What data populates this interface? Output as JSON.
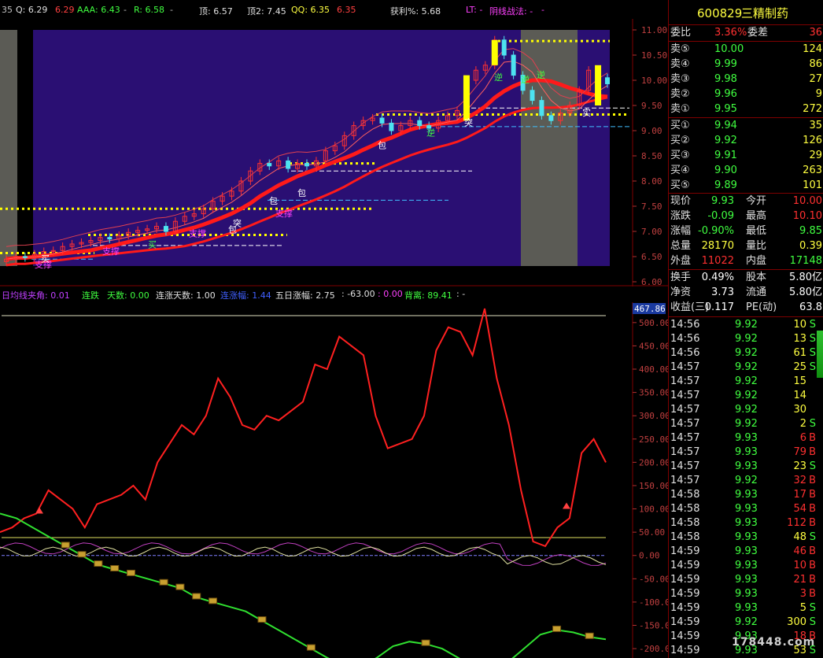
{
  "top_indicators": {
    "period": "35",
    "q_label": "Q: 6.29",
    "q_val2": "6.29",
    "aaa": "AAA: 6.43",
    "dash1": "-",
    "r": "R: 6.58",
    "dash2": "-",
    "top1": "顶: 6.57",
    "top2": "顶2: 7.45",
    "qq": "QQ: 6.35",
    "qq2": "6.35",
    "profit": "获利%: 5.68",
    "lt": "LT: -",
    "yinxian": "阴线战法: -",
    "dash3": "-"
  },
  "sub_header": {
    "angle": "日均线夹角: 0.01",
    "lianzhang": "连跌",
    "tianshu": "天数: 0.00",
    "lianzhangtianshu": "连涨天数: 1.00",
    "lianzhangfu": "连涨幅: 1.44",
    "wuri": "五日涨幅: 2.75",
    "neg63": ": -63.00",
    "zero": ": 0.00",
    "beili": "背离: 89.41",
    "dash": ":  -"
  },
  "colors": {
    "main_bg": "#2a0f73",
    "shade": "#5b5b55",
    "ma_thick": "#ff1a1a",
    "up_candle": "#ff3030",
    "down_candle": "#4de3f0",
    "yellow": "#ffff00",
    "red_line": "#ff2020",
    "green_line": "#30e030",
    "magenta": "#c040c0",
    "axis": "#b03030"
  },
  "chart_data": [
    {
      "type": "candlestick",
      "name": "main",
      "y_ticks": [
        "11.00",
        "10.50",
        "10.00",
        "9.50",
        "9.00",
        "8.50",
        "8.00",
        "7.50",
        "7.00",
        "6.50",
        "6.00"
      ],
      "ylim": [
        6.0,
        11.0
      ],
      "close": [
        6.45,
        6.5,
        6.48,
        6.55,
        6.6,
        6.62,
        6.7,
        6.75,
        6.78,
        6.82,
        6.88,
        6.85,
        6.92,
        6.98,
        7.02,
        7.05,
        7.1,
        7.0,
        7.2,
        7.3,
        7.35,
        7.45,
        7.6,
        7.7,
        7.8,
        8.0,
        8.2,
        8.35,
        8.3,
        8.4,
        8.25,
        8.35,
        8.3,
        8.4,
        8.6,
        8.7,
        8.9,
        9.1,
        9.2,
        9.25,
        9.15,
        9.0,
        9.1,
        9.2,
        9.1,
        9.05,
        9.2,
        9.3,
        9.4,
        10.0,
        10.2,
        10.3,
        10.8,
        10.5,
        10.1,
        9.8,
        9.6,
        9.3,
        9.2,
        9.35,
        9.5,
        9.8,
        10.2,
        10.05,
        9.93
      ],
      "annotations": [
        "支撑",
        "买",
        "支撑",
        "支撑",
        "突",
        "包",
        "包",
        "包",
        "包",
        "支撑",
        "逆",
        "逆",
        "突",
        "逆",
        "逆",
        "实",
        "买"
      ]
    },
    {
      "type": "line",
      "name": "sub",
      "y_ticks": [
        "500.00",
        "450.00",
        "400.00",
        "350.00",
        "300.00",
        "250.00",
        "200.00",
        "150.00",
        "100.00",
        "50.00",
        "0.00",
        "-50.00",
        "-100.00",
        "-150.00",
        "-200.00"
      ],
      "ylim": [
        -210,
        520
      ],
      "marker_value": "467.86",
      "series": [
        {
          "values": [
            50,
            60,
            80,
            90,
            140,
            120,
            100,
            60,
            110,
            120,
            130,
            150,
            120,
            200,
            240,
            280,
            260,
            300,
            380,
            340,
            280,
            270,
            300,
            290,
            310,
            330,
            410,
            400,
            470,
            450,
            430,
            300,
            230,
            240,
            250,
            300,
            440,
            490,
            480,
            430,
            530,
            380,
            280,
            140,
            30,
            20,
            60,
            80,
            220,
            250,
            200
          ]
        },
        {
          "values": [
            90,
            80,
            60,
            40,
            20,
            0,
            -20,
            -30,
            -40,
            -50,
            -60,
            -70,
            -90,
            -100,
            -110,
            -120,
            -140,
            -160,
            -180,
            -200,
            -220,
            -235,
            -240,
            -220,
            -195,
            -185,
            -190,
            -200,
            -220,
            -240,
            -250,
            -230,
            -200,
            -170,
            -160,
            -165,
            -175,
            -180
          ]
        }
      ]
    }
  ],
  "panel": {
    "code": "600829",
    "name": "三精制药",
    "weibi_label": "委比",
    "weibi_val": "3.36%",
    "weicha_label": "委差",
    "weicha_val": "36",
    "asks": [
      {
        "label": "卖⑤",
        "price": "10.00",
        "vol": "124"
      },
      {
        "label": "卖④",
        "price": "9.99",
        "vol": "86"
      },
      {
        "label": "卖③",
        "price": "9.98",
        "vol": "27"
      },
      {
        "label": "卖②",
        "price": "9.96",
        "vol": "9"
      },
      {
        "label": "卖①",
        "price": "9.95",
        "vol": "272"
      }
    ],
    "bids": [
      {
        "label": "买①",
        "price": "9.94",
        "vol": "35"
      },
      {
        "label": "买②",
        "price": "9.92",
        "vol": "126"
      },
      {
        "label": "买③",
        "price": "9.91",
        "vol": "29"
      },
      {
        "label": "买④",
        "price": "9.90",
        "vol": "263"
      },
      {
        "label": "买⑤",
        "price": "9.89",
        "vol": "101"
      }
    ],
    "quote": [
      {
        "l1": "现价",
        "v1": "9.93",
        "l2": "今开",
        "v2": "10.00"
      },
      {
        "l1": "涨跌",
        "v1": "-0.09",
        "l2": "最高",
        "v2": "10.10"
      },
      {
        "l1": "涨幅",
        "v1": "-0.90%",
        "l2": "最低",
        "v2": "9.85"
      },
      {
        "l1": "总量",
        "v1": "28170",
        "l2": "量比",
        "v2": "0.39"
      },
      {
        "l1": "外盘",
        "v1": "11022",
        "l2": "内盘",
        "v2": "17148"
      }
    ],
    "stats": [
      {
        "l1": "换手",
        "v1": "0.49%",
        "l2": "股本",
        "v2": "5.80亿"
      },
      {
        "l1": "净资",
        "v1": "3.73",
        "l2": "流通",
        "v2": "5.80亿"
      },
      {
        "l1": "收益(三)",
        "v1": "0.117",
        "l2": "PE(动)",
        "v2": "63.8"
      }
    ],
    "ticks": [
      {
        "t": "14:56",
        "p": "9.92",
        "v": "10",
        "s": "S"
      },
      {
        "t": "14:56",
        "p": "9.92",
        "v": "13",
        "s": "S"
      },
      {
        "t": "14:56",
        "p": "9.92",
        "v": "61",
        "s": "S"
      },
      {
        "t": "14:57",
        "p": "9.92",
        "v": "25",
        "s": "S"
      },
      {
        "t": "14:57",
        "p": "9.92",
        "v": "15",
        "s": ""
      },
      {
        "t": "14:57",
        "p": "9.92",
        "v": "14",
        "s": ""
      },
      {
        "t": "14:57",
        "p": "9.92",
        "v": "30",
        "s": ""
      },
      {
        "t": "14:57",
        "p": "9.92",
        "v": "2",
        "s": "S"
      },
      {
        "t": "14:57",
        "p": "9.93",
        "v": "6",
        "s": "B"
      },
      {
        "t": "14:57",
        "p": "9.93",
        "v": "79",
        "s": "B"
      },
      {
        "t": "14:57",
        "p": "9.93",
        "v": "23",
        "s": "S"
      },
      {
        "t": "14:57",
        "p": "9.92",
        "v": "32",
        "s": "B"
      },
      {
        "t": "14:58",
        "p": "9.93",
        "v": "17",
        "s": "B"
      },
      {
        "t": "14:58",
        "p": "9.93",
        "v": "54",
        "s": "B"
      },
      {
        "t": "14:58",
        "p": "9.93",
        "v": "112",
        "s": "B"
      },
      {
        "t": "14:58",
        "p": "9.93",
        "v": "48",
        "s": "S"
      },
      {
        "t": "14:59",
        "p": "9.93",
        "v": "46",
        "s": "B"
      },
      {
        "t": "14:59",
        "p": "9.93",
        "v": "10",
        "s": "B"
      },
      {
        "t": "14:59",
        "p": "9.93",
        "v": "21",
        "s": "B"
      },
      {
        "t": "14:59",
        "p": "9.93",
        "v": "3",
        "s": "B"
      },
      {
        "t": "14:59",
        "p": "9.93",
        "v": "5",
        "s": "S"
      },
      {
        "t": "14:59",
        "p": "9.92",
        "v": "300",
        "s": "S"
      },
      {
        "t": "14:59",
        "p": "9.93",
        "v": "18",
        "s": "B"
      },
      {
        "t": "14:59",
        "p": "9.93",
        "v": "53",
        "s": "S"
      }
    ],
    "watermark": "178448.com"
  }
}
